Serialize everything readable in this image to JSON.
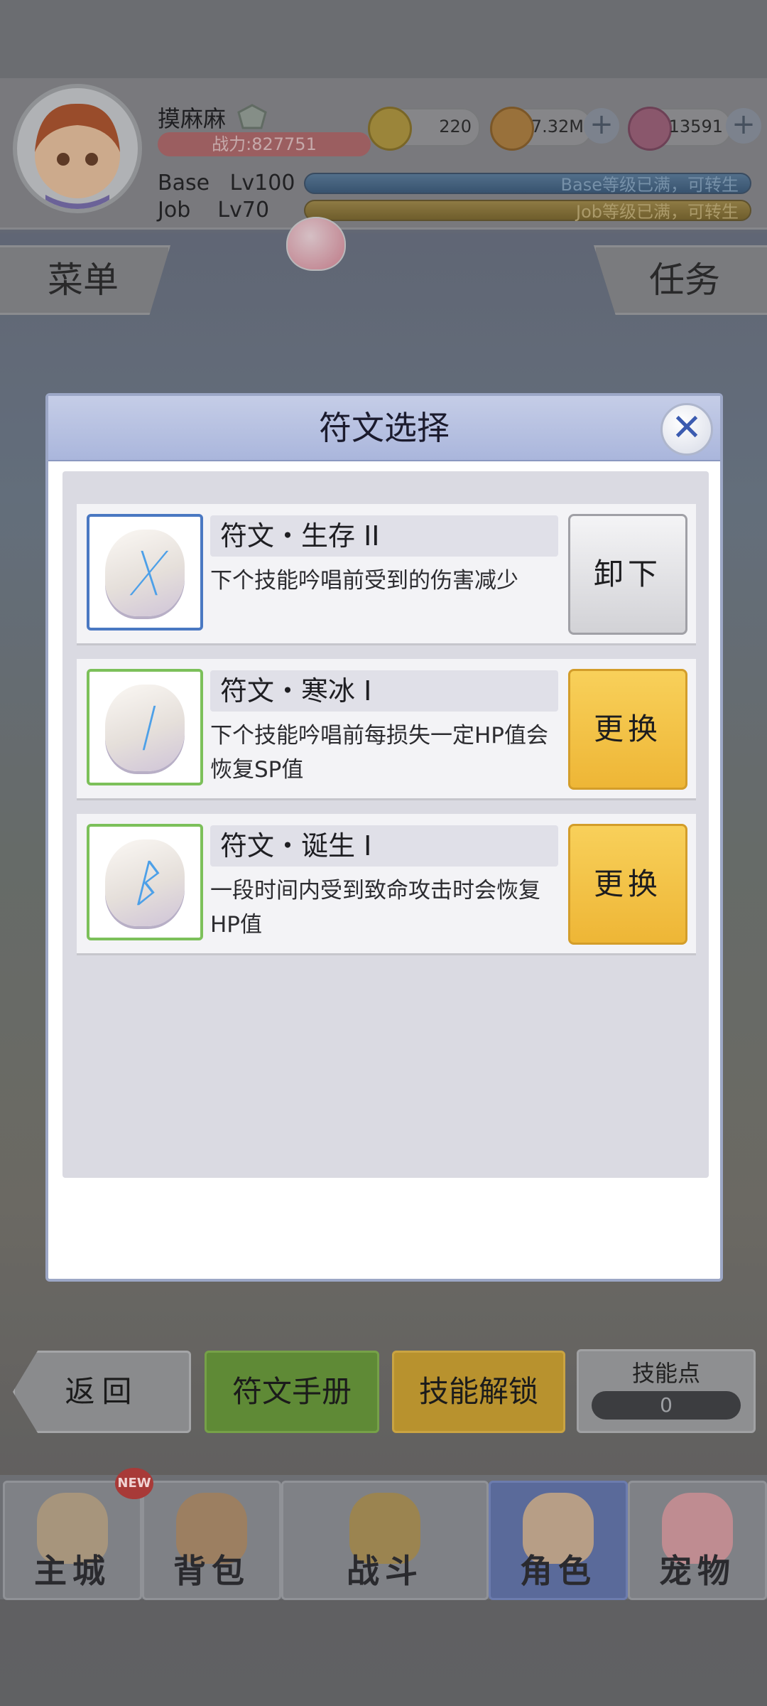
{
  "player": {
    "name": "摸麻麻",
    "power": "战力:827751",
    "base_label": "Base",
    "base_level": "Lv100",
    "base_status": "Base等级已满，可转生",
    "job_label": "Job",
    "job_level": "Lv70",
    "job_status": "Job等级已满，可转生"
  },
  "resources": {
    "zeny": "220",
    "coin": "7.32M",
    "gem": "13591",
    "plus": "+"
  },
  "side_tabs": {
    "menu": "菜单",
    "quest": "任务"
  },
  "modal": {
    "title": "符文选择",
    "close": "✕",
    "runes": [
      {
        "name": "符文・生存 II",
        "desc": "下个技能吟唱前受到的伤害减少",
        "button": "卸下",
        "glyph": "ᚷ",
        "frame": "blue"
      },
      {
        "name": "符文・寒冰 I",
        "desc": "下个技能吟唱前每损失一定HP值会恢复SP值",
        "button": "更换",
        "glyph": "ᛁ",
        "frame": "green"
      },
      {
        "name": "符文・诞生 I",
        "desc": "一段时间内受到致命攻击时会恢复HP值",
        "button": "更换",
        "glyph": "ᛒ",
        "frame": "green"
      }
    ]
  },
  "actions": {
    "back": "返回",
    "rune_manual": "符文手册",
    "skill_unlock": "技能解锁",
    "skill_points_label": "技能点",
    "skill_points": "0"
  },
  "nav": {
    "items": [
      {
        "label": "主城",
        "badge": "NEW"
      },
      {
        "label": "背包"
      },
      {
        "label": "战斗"
      },
      {
        "label": "角色"
      },
      {
        "label": "宠物"
      }
    ],
    "active_index": 3
  },
  "colors": {
    "accent_yellow": "#f0b93a",
    "frame_blue": "#4a78c2",
    "frame_green": "#7cc05a",
    "modal_header": "#b2bde0"
  }
}
